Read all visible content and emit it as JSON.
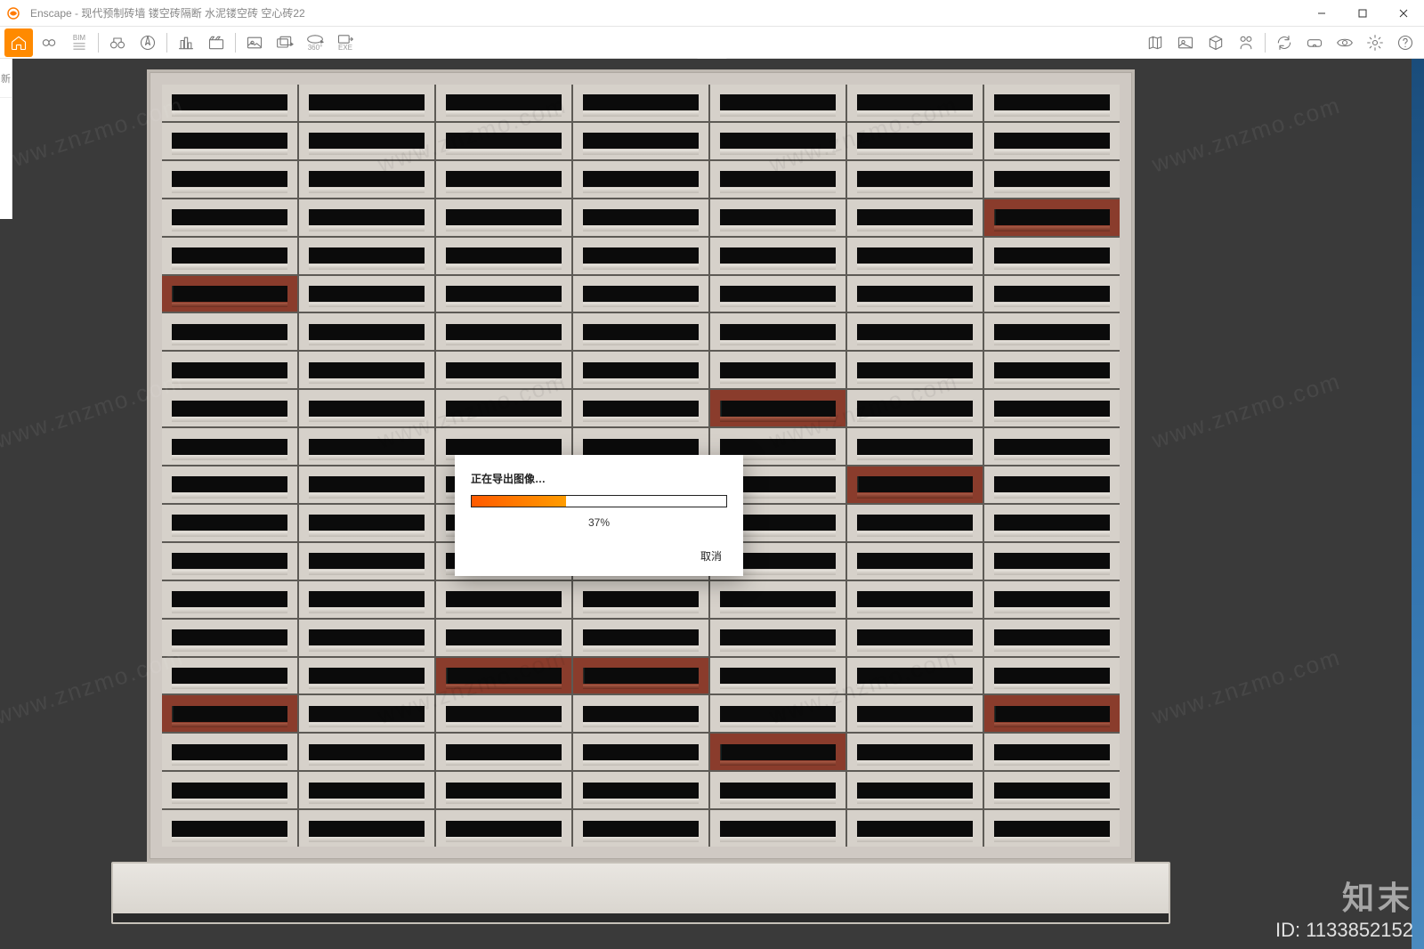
{
  "window": {
    "app_name": "Enscape",
    "title": "Enscape - 现代预制砖墙 镂空砖隔断 水泥镂空砖 空心砖22"
  },
  "toolbar_left": [
    {
      "name": "home",
      "label": ""
    },
    {
      "name": "link",
      "label": ""
    },
    {
      "name": "bim-manage",
      "label": "BIM"
    },
    {
      "name": "binoculars",
      "label": ""
    },
    {
      "name": "compass",
      "label": ""
    },
    {
      "name": "site",
      "label": ""
    },
    {
      "name": "clapper",
      "label": ""
    },
    {
      "name": "screenshot",
      "label": ""
    },
    {
      "name": "batch-render",
      "label": ""
    },
    {
      "name": "panorama-360",
      "label": "360°"
    },
    {
      "name": "export-exe",
      "label": "EXE"
    }
  ],
  "toolbar_right": [
    {
      "name": "map"
    },
    {
      "name": "asset-library"
    },
    {
      "name": "box"
    },
    {
      "name": "collab"
    },
    {
      "name": "sync"
    },
    {
      "name": "vr"
    },
    {
      "name": "visual-settings"
    },
    {
      "name": "settings"
    },
    {
      "name": "help"
    }
  ],
  "left_strip": {
    "items": [
      "新",
      "",
      ""
    ]
  },
  "dialog": {
    "title": "正在导出图像…",
    "percent_value": 37,
    "percent_text": "37%",
    "cancel_label": "取消"
  },
  "wall": {
    "cols": 7,
    "rows": 20,
    "red_cells": [
      {
        "r": 3,
        "c": 6
      },
      {
        "r": 5,
        "c": 0
      },
      {
        "r": 8,
        "c": 4
      },
      {
        "r": 10,
        "c": 5
      },
      {
        "r": 15,
        "c": 2
      },
      {
        "r": 15,
        "c": 3
      },
      {
        "r": 16,
        "c": 0
      },
      {
        "r": 16,
        "c": 6
      },
      {
        "r": 17,
        "c": 4
      }
    ]
  },
  "watermark": {
    "text": "www.znzmo.com",
    "brand": "知末",
    "id_label": "ID: 1133852152"
  }
}
